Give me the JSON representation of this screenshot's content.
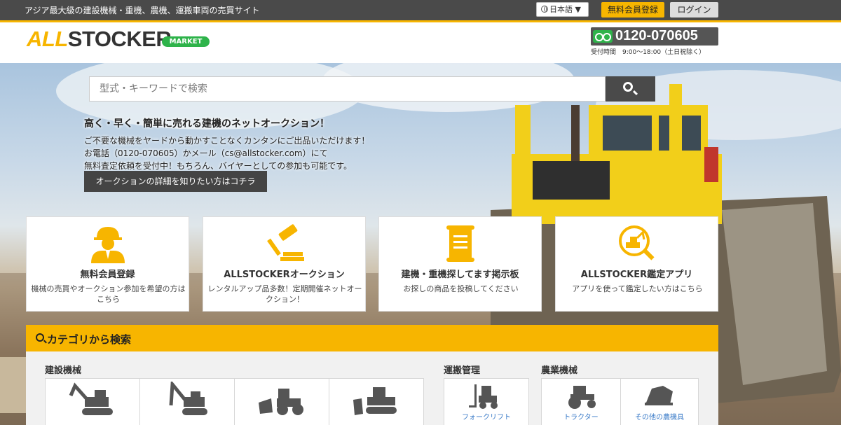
{
  "topbar": {
    "tagline": "アジア最大級の建設機械・重機、農機、運搬車両の売買サイト",
    "language": "日本語",
    "register": "無料会員登録",
    "login": "ログイン"
  },
  "header": {
    "logo_all": "ALL",
    "logo_stocker": "STOCKER",
    "market_badge": "MARKET",
    "phone": "0120-070605",
    "hours": "受付時間　9:00〜18:00（土日祝除く）"
  },
  "search": {
    "placeholder": "型式・キーワードで検索"
  },
  "intro": {
    "headline": "高く・早く・簡単に売れる建機のネットオークション！",
    "line1": "ご不要な機械をヤードから動かすことなくカンタンにご出品いただけます！",
    "line2": "お電話（0120-070605）かメール（cs@allstocker.com）にて",
    "line3": "無料査定依頼を受付中！もちろん、バイヤーとしての参加も可能です。",
    "cta": "オークションの詳細を知りたい方はコチラ"
  },
  "cards": [
    {
      "title": "無料会員登録",
      "desc": "機械の売買やオークション参加を希望の方はこちら",
      "icon": "worker-icon"
    },
    {
      "title": "ALLSTOCKERオークション",
      "desc": "レンタルアップ品多数！定期開催ネットオークション！",
      "icon": "gavel-icon"
    },
    {
      "title": "建機・重機探してます掲示板",
      "desc": "お探しの商品を投稿してください",
      "icon": "scroll-icon"
    },
    {
      "title": "ALLSTOCKER鑑定アプリ",
      "desc": "アプリを使って鑑定したい方はこちら",
      "icon": "appraisal-icon"
    }
  ],
  "categories": {
    "heading": "カテゴリから検索",
    "construction": "建設機械",
    "transport": "運搬管理",
    "transport_items": [
      "フォークリフト"
    ],
    "agriculture": "農業機械",
    "agriculture_items": [
      "トラクター",
      "その他の農機具"
    ]
  },
  "colors": {
    "accent": "#f7b500",
    "topbar": "#4a4a4a",
    "market_green": "#2eb34a",
    "link": "#3a7bc8"
  }
}
